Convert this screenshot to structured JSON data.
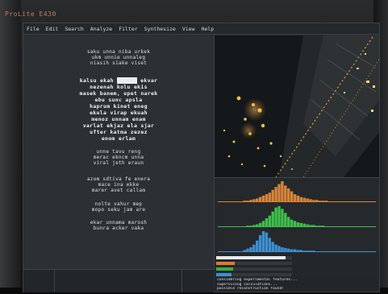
{
  "window": {
    "title": "ProLite E430"
  },
  "menu": {
    "items": [
      "File",
      "Edit",
      "Search",
      "Analyze",
      "Filter",
      "Synthesize",
      "View",
      "Help"
    ]
  },
  "text_panel": {
    "block1": [
      "saku unna niba urkek",
      "ukm unnie unnaleg",
      "niasih siake viset"
    ],
    "block2": [
      "kalsu ekah ",
      " ekvar",
      "nezenah kolu ekis",
      "masek banem, upet narek",
      "ebu sunc apsla",
      "haprum kinet eneg",
      "ekula virap ekuah",
      "menoz unnam enam",
      "varlat ekjaz ela sjar",
      "ufter katma zezez",
      "enom erlam"
    ],
    "block3": [
      "unne tavu reng",
      "merac ekncm unna",
      "viral jeth eraun"
    ],
    "block4": [
      "azom sdtiva fe enera",
      "mace ina ekke",
      "marer avet callam"
    ],
    "block5": [
      "nolte vahur mep",
      "mopo seku jam are"
    ],
    "block6": [
      "ekar unnama marosh",
      "bunra acker vaka"
    ]
  },
  "histograms": [
    {
      "name": "orange-channel",
      "color": "#d7843a",
      "values": [
        0,
        0,
        0,
        0,
        0,
        0,
        1,
        1,
        2,
        3,
        4,
        6,
        8,
        10,
        12,
        16,
        20,
        24,
        28,
        22,
        18,
        14,
        10,
        8,
        6,
        5,
        4,
        3,
        2,
        2,
        1,
        1,
        1,
        0,
        0,
        0,
        0,
        0,
        0,
        0
      ]
    },
    {
      "name": "green-channel",
      "color": "#3ec04a",
      "values": [
        0,
        0,
        0,
        0,
        0,
        0,
        0,
        1,
        1,
        2,
        3,
        5,
        8,
        12,
        16,
        22,
        28,
        30,
        26,
        20,
        14,
        10,
        8,
        6,
        5,
        4,
        3,
        2,
        2,
        1,
        1,
        1,
        0,
        0,
        0,
        0,
        0,
        0,
        0,
        0
      ]
    },
    {
      "name": "blue-channel",
      "color": "#3d8fd0",
      "values": [
        0,
        0,
        0,
        0,
        0,
        0,
        2,
        4,
        6,
        10,
        16,
        24,
        30,
        28,
        20,
        14,
        10,
        8,
        6,
        5,
        4,
        3,
        3,
        2,
        2,
        1,
        1,
        1,
        1,
        0,
        0,
        0,
        0,
        0,
        0,
        0,
        0,
        0,
        0,
        0
      ]
    }
  ],
  "progress": [
    {
      "name": "white-progress",
      "color": "#e8ecef",
      "fraction": 0.92
    },
    {
      "name": "orange-progress",
      "color": "#e07a2a",
      "fraction": 0.24
    },
    {
      "name": "green-progress",
      "color": "#3cae44",
      "fraction": 0.22
    },
    {
      "name": "blue-progress",
      "color": "#3d8fd0",
      "fraction": 0.2
    }
  ],
  "status": {
    "lines": [
      "considering experimental features...",
      "supervising calculations...",
      "possible reconstruction found!"
    ]
  },
  "colors": {
    "screen_bg": "#2b2e31",
    "title": "#d88a6a"
  }
}
